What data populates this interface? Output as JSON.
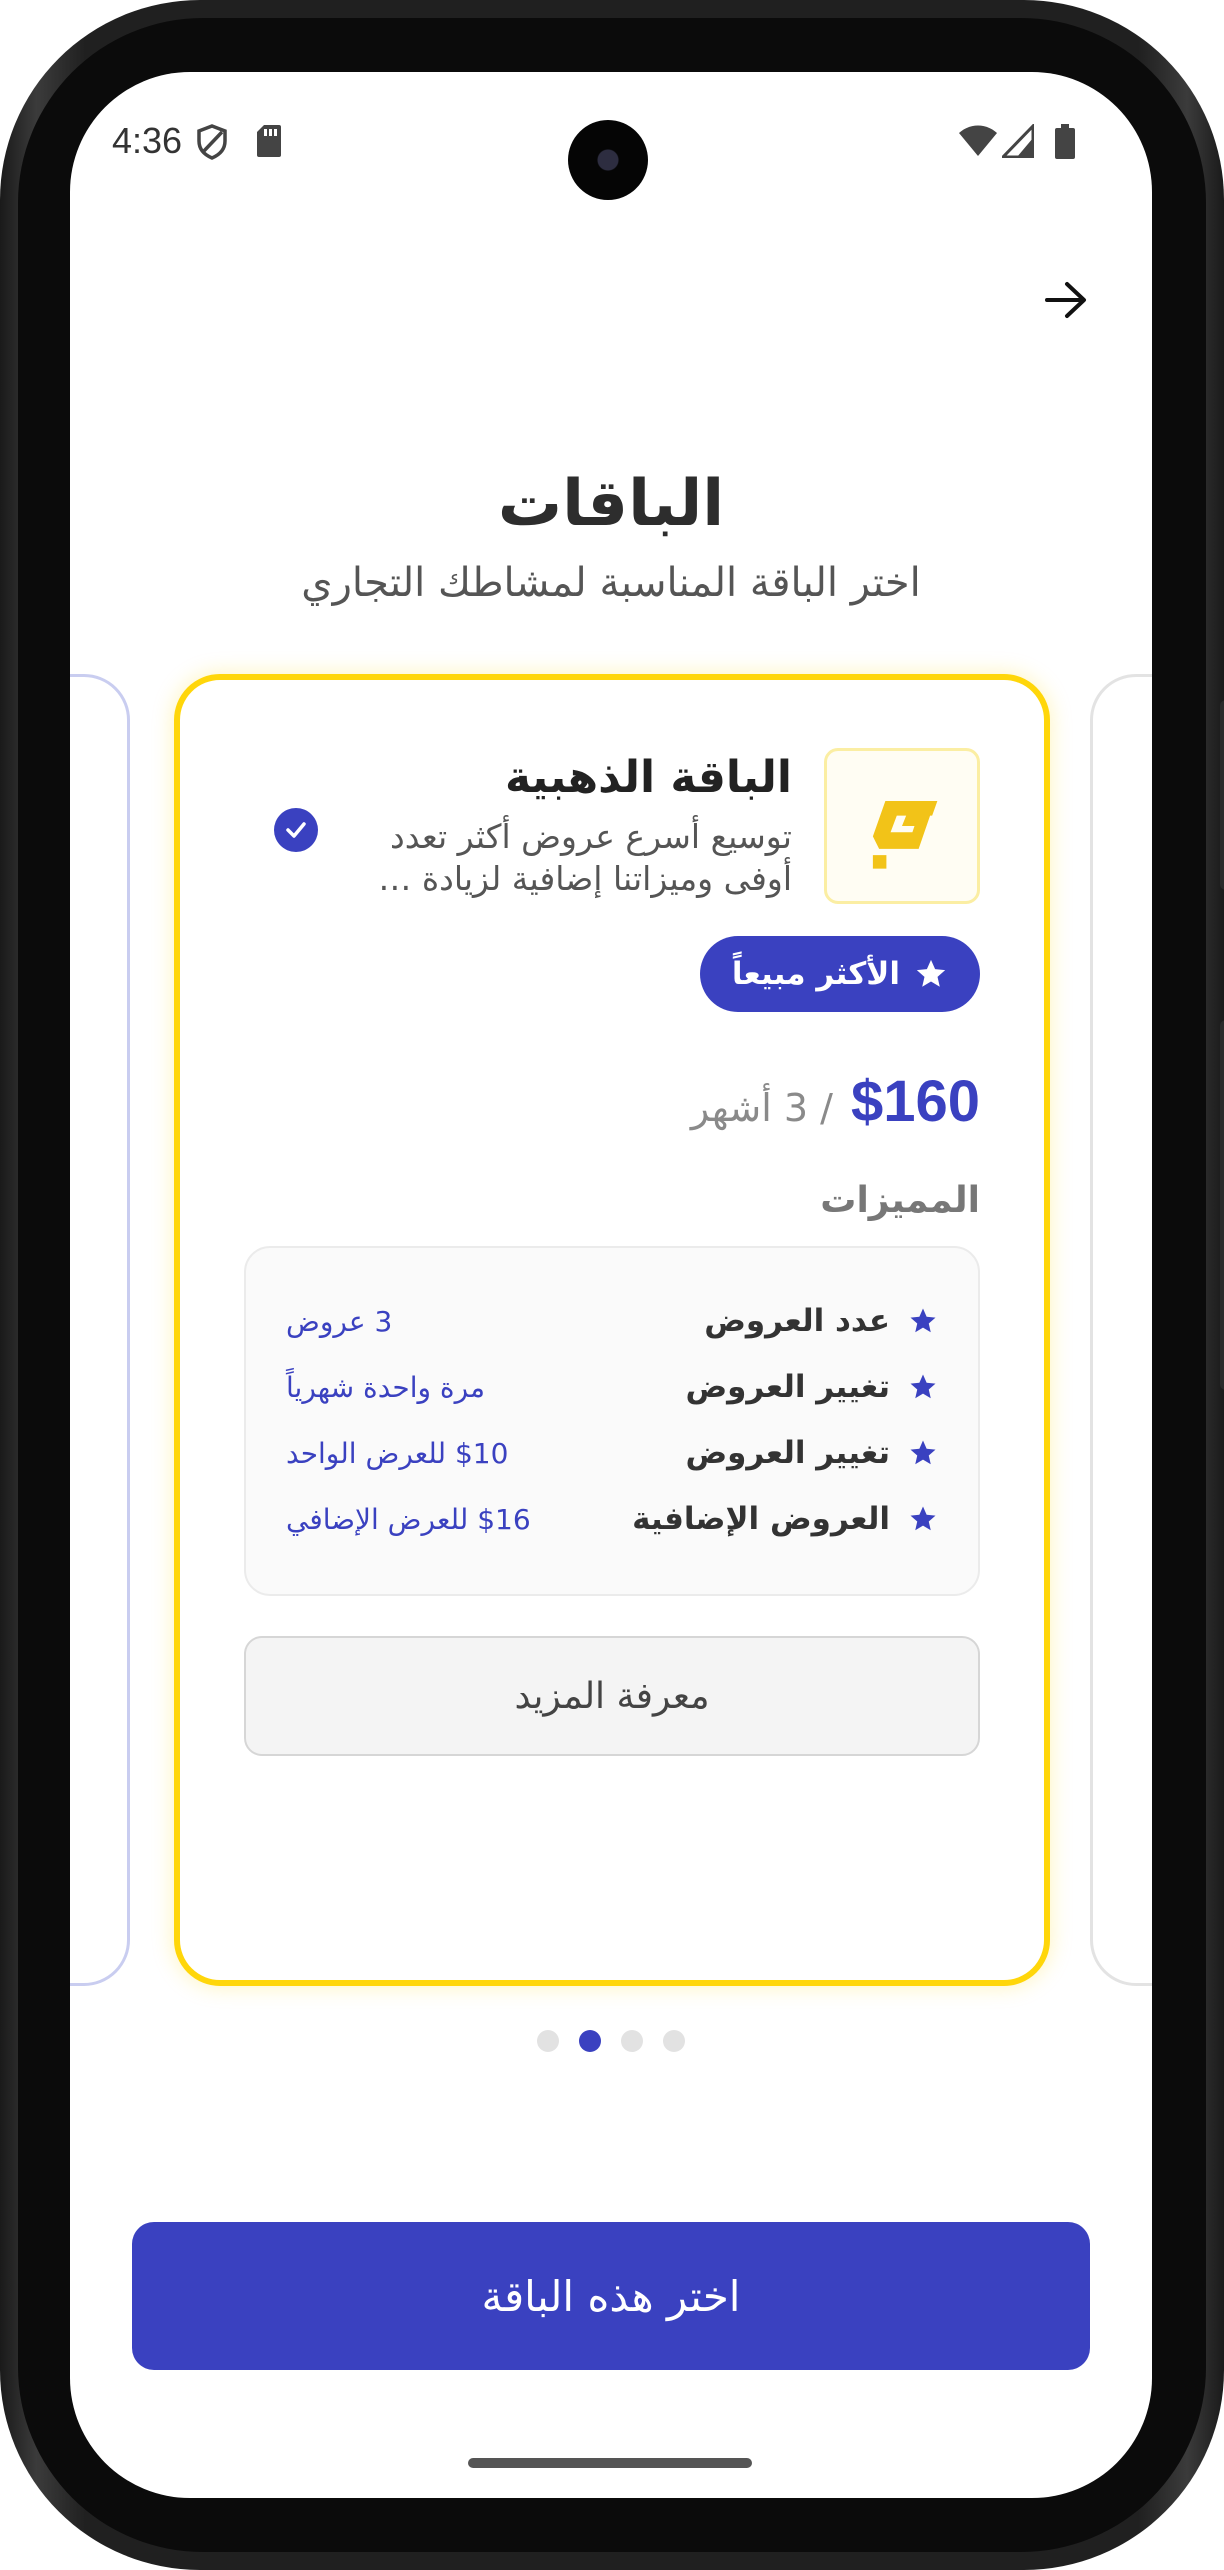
{
  "status_bar": {
    "time": "4:36",
    "icons": [
      "shield-icon",
      "sim-card-icon",
      "wifi-icon",
      "signal-icon",
      "battery-icon"
    ]
  },
  "header": {
    "back_icon": "arrow-right-icon",
    "title": "الباقات",
    "subtitle": "اختر الباقة المناسبة لمشاطك التجاري"
  },
  "plan": {
    "name": "الباقة الذهبية",
    "description": "توسيع أسرع عروض أكثر تعدد أوفى وميزاتنا إضافية لزيادة …",
    "selected": true,
    "badge": "الأكثر مبيعاً",
    "price": "$160",
    "period": "/ 3 أشهر",
    "features_heading": "المميزات",
    "features": [
      {
        "name": "عدد العروض",
        "value": "3 عروض"
      },
      {
        "name": "تغيير العروض",
        "value": "مرة واحدة شهرياً"
      },
      {
        "name": "تغيير العروض",
        "value": "$10 للعرض الواحد"
      },
      {
        "name": "العروض الإضافية",
        "value": "$16 للعرض الإضافي"
      }
    ],
    "more_button": "معرفة المزيد"
  },
  "pagination": {
    "count": 4,
    "active_index": 1
  },
  "cta": {
    "label": "اختر هذه الباقة"
  },
  "colors": {
    "primary": "#3a41c0",
    "gold": "#ffd60a",
    "logo_yellow": "#f2c318"
  }
}
